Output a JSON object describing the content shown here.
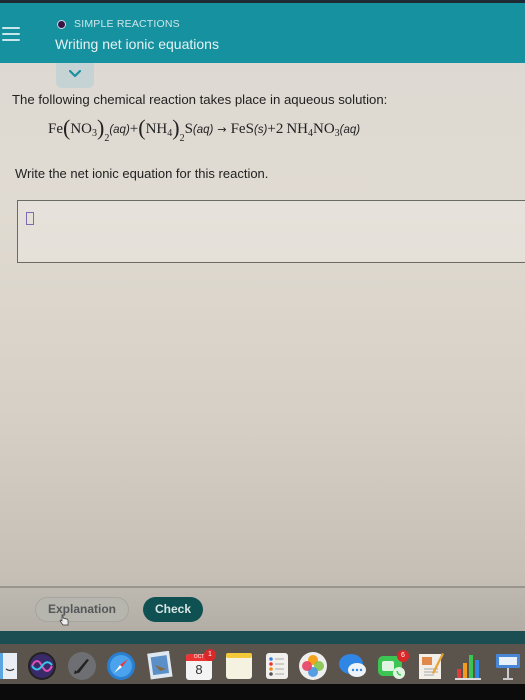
{
  "header": {
    "section": "SIMPLE REACTIONS",
    "title": "Writing net ionic equations",
    "menu_icon": "hamburger-menu-icon",
    "section_dot_color": "#3a1244",
    "background_color": "#16919f"
  },
  "collapse_toggle": {
    "icon": "chevron-down-icon",
    "color": "#1c8fa0"
  },
  "question": {
    "intro": "The following chemical reaction takes place in aqueous solution:",
    "equation": {
      "reactant1": {
        "element": "Fe",
        "group": "NO",
        "group_sub": "3",
        "count_sub": "2",
        "state": "(aq)"
      },
      "plus1": "+",
      "reactant2": {
        "group": "NH",
        "group_sub": "4",
        "count_sub": "2",
        "tail": "S",
        "state": "(aq)"
      },
      "arrow": "→",
      "product1": {
        "formula": "FeS",
        "state": "(s)"
      },
      "plus2": "+",
      "product2": {
        "coef": "2",
        "part1": "NH",
        "sub1": "4",
        "part2": "NO",
        "sub2": "3",
        "state": "(aq)"
      }
    },
    "prompt": "Write the net ionic equation for this reaction."
  },
  "answer": {
    "value": "",
    "placeholder": ""
  },
  "buttons": {
    "explanation": "Explanation",
    "check": "Check",
    "check_color": "#0f5052"
  },
  "dock": {
    "items": [
      {
        "name": "finder",
        "icon": "finder-icon",
        "running": true
      },
      {
        "name": "siri",
        "icon": "siri-icon",
        "running": false
      },
      {
        "name": "launchpad",
        "icon": "rocket-icon",
        "running": false
      },
      {
        "name": "safari",
        "icon": "compass-icon",
        "running": true
      },
      {
        "name": "mail",
        "icon": "mail-eagle-icon",
        "running": false
      },
      {
        "name": "calendar",
        "icon": "calendar-icon",
        "month": "OCT",
        "day": "8",
        "badge": "1",
        "running": false
      },
      {
        "name": "notes",
        "icon": "notes-icon",
        "running": false
      },
      {
        "name": "reminders",
        "icon": "reminders-icon",
        "running": false
      },
      {
        "name": "photos",
        "icon": "photos-icon",
        "running": false
      },
      {
        "name": "messages",
        "icon": "messages-icon",
        "running": false
      },
      {
        "name": "facetime",
        "icon": "facetime-icon",
        "badge": "6",
        "running": false
      },
      {
        "name": "pages",
        "icon": "pages-icon",
        "running": true
      },
      {
        "name": "numbers",
        "icon": "numbers-icon",
        "running": false
      },
      {
        "name": "keynote",
        "icon": "keynote-icon",
        "running": false
      }
    ]
  }
}
